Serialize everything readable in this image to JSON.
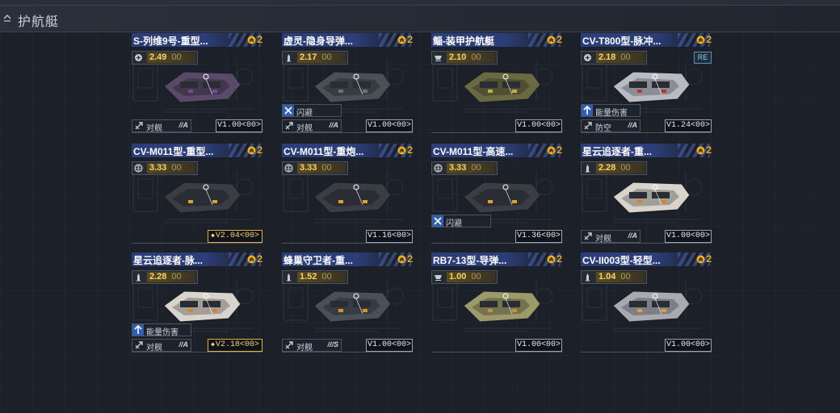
{
  "header": {
    "title": "护航艇"
  },
  "cards": [
    {
      "name": "S-列维9号-重型...",
      "rank": "2",
      "cost": "2.49",
      "cost_icon": "shield-icon",
      "ability": "",
      "role": "对舰",
      "role_rank": "//A",
      "version": "V1.00<00>",
      "version_highlight": false,
      "re": "",
      "hull_color": "#5a4a6a",
      "accent": "#7a4a9a"
    },
    {
      "name": "虚灵-隐身导弹...",
      "rank": "2",
      "cost": "2.17",
      "cost_icon": "missile-icon",
      "ability": "闪避",
      "ability_icon": "dodge-icon",
      "role": "对舰",
      "role_rank": "//A",
      "version": "V1.00<00>",
      "version_highlight": false,
      "re": "",
      "hull_color": "#4a4f58",
      "accent": "#6b717c"
    },
    {
      "name": "鲻-装甲护航艇",
      "rank": "2",
      "cost": "2.10",
      "cost_icon": "armor-icon",
      "ability": "",
      "role": "",
      "role_rank": "",
      "version": "V1.00<00>",
      "version_highlight": false,
      "re": "",
      "hull_color": "#6a6a42",
      "accent": "#c8b040"
    },
    {
      "name": "CV-T800型-脉冲...",
      "rank": "2",
      "cost": "2.18",
      "cost_icon": "shield-icon",
      "ability": "能量伤害",
      "ability_icon": "energy-icon",
      "role": "防空",
      "role_rank": "//A",
      "version": "V1.24<00>",
      "version_highlight": false,
      "re": "RE",
      "hull_color": "#b8bcc2",
      "accent": "#c03030"
    },
    {
      "name": "CV-M011型-重型...",
      "rank": "2",
      "cost": "3.33",
      "cost_icon": "globe-icon",
      "ability": "",
      "role": "",
      "role_rank": "",
      "version": "V2.04<00>",
      "version_highlight": true,
      "re": "",
      "hull_color": "#3a3d44",
      "accent": "#e0a030"
    },
    {
      "name": "CV-M011型-重炮...",
      "rank": "2",
      "cost": "3.33",
      "cost_icon": "globe-icon",
      "ability": "",
      "role": "",
      "role_rank": "",
      "version": "V1.16<00>",
      "version_highlight": false,
      "re": "",
      "hull_color": "#3a3d44",
      "accent": "#e0a030"
    },
    {
      "name": "CV-M011型-高速...",
      "rank": "2",
      "cost": "3.33",
      "cost_icon": "globe-icon",
      "ability": "闪避",
      "ability_icon": "dodge-icon",
      "role": "",
      "role_rank": "",
      "version": "V1.36<00>",
      "version_highlight": false,
      "re": "",
      "hull_color": "#3a3d44",
      "accent": "#e0a030"
    },
    {
      "name": "星云追逐者-重...",
      "rank": "2",
      "cost": "2.28",
      "cost_icon": "missile-icon",
      "ability": "",
      "role": "对舰",
      "role_rank": "//A",
      "version": "V1.00<00>",
      "version_highlight": false,
      "re": "",
      "hull_color": "#d8d4cc",
      "accent": "#e08020"
    },
    {
      "name": "星云追逐者-脉...",
      "rank": "2",
      "cost": "2.28",
      "cost_icon": "missile-icon",
      "ability": "能量伤害",
      "ability_icon": "energy-icon",
      "role": "对舰",
      "role_rank": "//A",
      "version": "V2.18<00>",
      "version_highlight": true,
      "re": "",
      "hull_color": "#d8d4cc",
      "accent": "#e08020"
    },
    {
      "name": "蜂巢守卫者-重...",
      "rank": "2",
      "cost": "1.52",
      "cost_icon": "missile-icon",
      "ability": "",
      "role": "对舰",
      "role_rank": "///S",
      "version": "V1.00<00>",
      "version_highlight": false,
      "re": "",
      "hull_color": "#4a4f5a",
      "accent": "#e09020"
    },
    {
      "name": "RB7-13型-导弹...",
      "rank": "2",
      "cost": "1.00",
      "cost_icon": "armor-icon",
      "ability": "",
      "role": "",
      "role_rank": "",
      "version": "V1.00<00>",
      "version_highlight": false,
      "re": "",
      "hull_color": "#9a9a6a",
      "accent": "#c89030"
    },
    {
      "name": "CV-II003型-轻型...",
      "rank": "2",
      "cost": "1.04",
      "cost_icon": "missile-icon",
      "ability": "",
      "role": "",
      "role_rank": "",
      "version": "V1.00<00>",
      "version_highlight": false,
      "re": "",
      "hull_color": "#a8aab0",
      "accent": "#e0a030"
    }
  ],
  "cost_suffix": "00"
}
